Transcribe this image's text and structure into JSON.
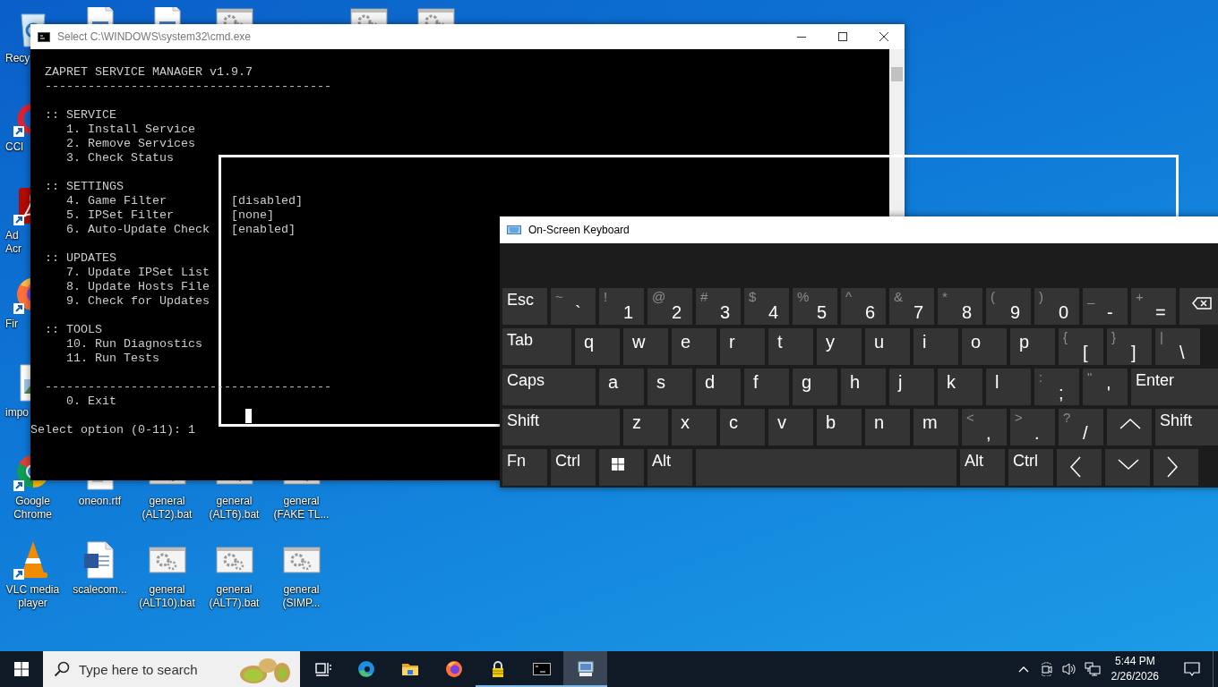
{
  "desktop_icons": [
    {
      "kind": "recycle",
      "label": "Recy"
    },
    {
      "kind": "ccleaner",
      "label": "CCl",
      "shortcut": true
    },
    {
      "kind": "acrobat",
      "label": "Ad Acr",
      "shortcut": true
    },
    {
      "kind": "firefox",
      "label": "Fir",
      "shortcut": true
    },
    {
      "kind": "image",
      "label": "impo"
    },
    {
      "kind": "chrome",
      "label": "Google Chrome",
      "shortcut": true
    },
    {
      "kind": "vlc",
      "label": "VLC media player",
      "shortcut": true
    },
    {
      "kind": "document"
    },
    {
      "kind": "rtf",
      "label": "oneon.rtf"
    },
    {
      "kind": "word",
      "label": "scalecom..."
    },
    {
      "kind": "document"
    },
    {
      "kind": "bat",
      "label": "general (ALT2).bat"
    },
    {
      "kind": "bat",
      "label": "general (ALT10).bat"
    },
    {
      "kind": "bat"
    },
    {
      "kind": "bat",
      "label": "general (ALT6).bat"
    },
    {
      "kind": "bat",
      "label": "general (ALT7).bat"
    },
    {
      "kind": "bat",
      "label": "general (FAKE TL..."
    },
    {
      "kind": "bat",
      "label": "general (SIMP..."
    },
    {
      "kind": "bat"
    },
    {
      "kind": "bat"
    }
  ],
  "console_window": {
    "title": "Select C:\\WINDOWS\\system32\\cmd.exe",
    "blocks": [
      [
        {
          "kind": "title",
          "text": "ZAPRET SERVICE MANAGER v1.9.7"
        },
        {
          "kind": "rule",
          "text": "----------------------------------------"
        }
      ],
      [
        {
          "kind": "heading",
          "text": ":: SERVICE"
        },
        {
          "kind": "item",
          "text": "1. Install Service"
        },
        {
          "kind": "item",
          "text": "2. Remove Services"
        },
        {
          "kind": "item",
          "text": "3. Check Status"
        }
      ],
      [
        {
          "kind": "heading",
          "text": ":: SETTINGS"
        },
        {
          "kind": "item",
          "text": "4. Game Filter",
          "value": "[disabled]"
        },
        {
          "kind": "item",
          "text": "5. IPSet Filter",
          "value": "[none]"
        },
        {
          "kind": "item",
          "text": "6. Auto-Update Check",
          "value": "[enabled]"
        }
      ],
      [
        {
          "kind": "heading",
          "text": ":: UPDATES"
        },
        {
          "kind": "item",
          "text": "7. Update IPSet List"
        },
        {
          "kind": "item",
          "text": "8. Update Hosts File"
        },
        {
          "kind": "item",
          "text": "9. Check for Updates"
        }
      ],
      [
        {
          "kind": "heading",
          "text": ":: TOOLS"
        },
        {
          "kind": "item",
          "text": "10. Run Diagnostics"
        },
        {
          "kind": "item",
          "text": "11. Run Tests"
        }
      ],
      [
        {
          "kind": "rule",
          "text": "----------------------------------------"
        },
        {
          "kind": "item",
          "text": "0. Exit"
        }
      ],
      [
        {
          "kind": "prompt",
          "text": "Select option (0-11): 1"
        }
      ]
    ]
  },
  "keyboard_window": {
    "title": "On-Screen Keyboard",
    "rows": [
      [
        {
          "kind": "word",
          "label": "Esc"
        },
        {
          "kind": "char",
          "shift": "~",
          "label": "`"
        },
        {
          "kind": "char",
          "shift": "!",
          "label": "1"
        },
        {
          "kind": "char",
          "shift": "@",
          "label": "2"
        },
        {
          "kind": "char",
          "shift": "#",
          "label": "3"
        },
        {
          "kind": "char",
          "shift": "$",
          "label": "4"
        },
        {
          "kind": "char",
          "shift": "%",
          "label": "5"
        },
        {
          "kind": "char",
          "shift": "^",
          "label": "6"
        },
        {
          "kind": "char",
          "shift": "&",
          "label": "7"
        },
        {
          "kind": "char",
          "shift": "*",
          "label": "8"
        },
        {
          "kind": "char",
          "shift": "(",
          "label": "9"
        },
        {
          "kind": "char",
          "shift": ")",
          "label": "0"
        },
        {
          "kind": "char",
          "shift": "_",
          "label": "-"
        },
        {
          "kind": "char",
          "shift": "+",
          "label": "="
        },
        {
          "kind": "backspace"
        }
      ],
      [
        {
          "kind": "word",
          "label": "Tab"
        },
        {
          "kind": "char",
          "label": "q"
        },
        {
          "kind": "char",
          "label": "w"
        },
        {
          "kind": "char",
          "label": "e"
        },
        {
          "kind": "char",
          "label": "r"
        },
        {
          "kind": "char",
          "label": "t"
        },
        {
          "kind": "char",
          "label": "y"
        },
        {
          "kind": "char",
          "label": "u"
        },
        {
          "kind": "char",
          "label": "i"
        },
        {
          "kind": "char",
          "label": "o"
        },
        {
          "kind": "char",
          "label": "p"
        },
        {
          "kind": "char",
          "shift": "{",
          "label": "["
        },
        {
          "kind": "char",
          "shift": "}",
          "label": "]"
        },
        {
          "kind": "char",
          "shift": "|",
          "label": "\\"
        }
      ],
      [
        {
          "kind": "word",
          "label": "Caps"
        },
        {
          "kind": "char",
          "label": "a"
        },
        {
          "kind": "char",
          "label": "s"
        },
        {
          "kind": "char",
          "label": "d"
        },
        {
          "kind": "char",
          "label": "f"
        },
        {
          "kind": "char",
          "label": "g"
        },
        {
          "kind": "char",
          "label": "h"
        },
        {
          "kind": "char",
          "label": "j"
        },
        {
          "kind": "char",
          "label": "k"
        },
        {
          "kind": "char",
          "label": "l"
        },
        {
          "kind": "char",
          "shift": ":",
          "label": ";"
        },
        {
          "kind": "char",
          "shift": "\"",
          "label": "'"
        },
        {
          "kind": "word",
          "label": "Enter"
        }
      ],
      [
        {
          "kind": "word",
          "label": "Shift"
        },
        {
          "kind": "char",
          "label": "z"
        },
        {
          "kind": "char",
          "label": "x"
        },
        {
          "kind": "char",
          "label": "c"
        },
        {
          "kind": "char",
          "label": "v"
        },
        {
          "kind": "char",
          "label": "b"
        },
        {
          "kind": "char",
          "label": "n"
        },
        {
          "kind": "char",
          "label": "m"
        },
        {
          "kind": "char",
          "shift": "<",
          "label": ","
        },
        {
          "kind": "char",
          "shift": ">",
          "label": "."
        },
        {
          "kind": "char",
          "shift": "?",
          "label": "/"
        },
        {
          "kind": "up"
        },
        {
          "kind": "word",
          "label": "Shift"
        }
      ],
      [
        {
          "kind": "word",
          "label": "Fn"
        },
        {
          "kind": "word",
          "label": "Ctrl"
        },
        {
          "kind": "windows"
        },
        {
          "kind": "word",
          "label": "Alt"
        },
        {
          "kind": "space"
        },
        {
          "kind": "word",
          "label": "Alt"
        },
        {
          "kind": "word",
          "label": "Ctrl"
        },
        {
          "kind": "left"
        },
        {
          "kind": "down"
        },
        {
          "kind": "right"
        }
      ]
    ]
  },
  "taskbar": {
    "search": {
      "placeholder": "Type here to search"
    },
    "apps": [
      {
        "kind": "taskview",
        "running": false,
        "selected": false
      },
      {
        "kind": "edge",
        "running": false,
        "selected": false
      },
      {
        "kind": "explorer",
        "running": false,
        "selected": false
      },
      {
        "kind": "firefox",
        "running": false,
        "selected": false
      },
      {
        "kind": "lock",
        "running": true,
        "selected": false
      },
      {
        "kind": "cmd",
        "running": true,
        "selected": false
      },
      {
        "kind": "keyboard",
        "running": true,
        "selected": true
      }
    ],
    "clock": {
      "time": "5:44 PM",
      "date": "2/26/2026"
    }
  }
}
